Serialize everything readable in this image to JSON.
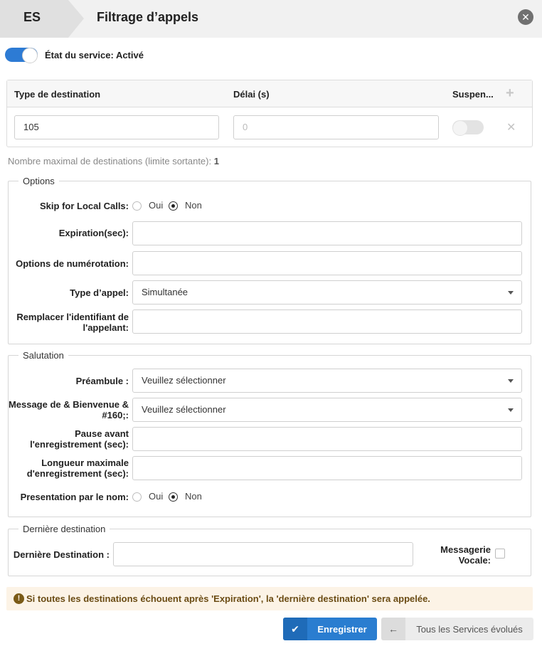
{
  "header": {
    "badge": "ES",
    "title": "Filtrage d’appels"
  },
  "service": {
    "status_label": "État du service: Activé",
    "enabled": true
  },
  "destinations": {
    "columns": {
      "type": "Type de destination",
      "delay": "Délai (s)",
      "suspend": "Suspen..."
    },
    "rows": [
      {
        "type": "105",
        "delay": "0",
        "suspended": false
      }
    ],
    "limit_label": "Nombre maximal de destinations (limite sortante):",
    "limit_value": "1"
  },
  "options": {
    "legend": "Options",
    "skip_local_calls": {
      "label": "Skip for Local Calls:",
      "yes": "Oui",
      "no": "Non",
      "selected": "no"
    },
    "expiration": {
      "label": "Expiration(sec):",
      "value": ""
    },
    "dial_options": {
      "label": "Options de numérotation:",
      "value": ""
    },
    "call_type": {
      "label": "Type d’appel:",
      "value": "Simultanée"
    },
    "replace_caller_id": {
      "label": "Remplacer l'identifiant de l'appelant:",
      "value": ""
    }
  },
  "greeting": {
    "legend": "Salutation",
    "preamble": {
      "label": "Préambule :",
      "value": "Veuillez sélectionner"
    },
    "welcome": {
      "label": "Message de & Bienvenue & #160;:",
      "value": "Veuillez sélectionner"
    },
    "pause": {
      "label": "Pause avant l'enregistrement (sec):",
      "value": ""
    },
    "max_length": {
      "label": "Longueur maximale d'enregistrement (sec):",
      "value": ""
    },
    "name_presentation": {
      "label": "Presentation par le nom:",
      "yes": "Oui",
      "no": "Non",
      "selected": "no"
    }
  },
  "last_destination": {
    "legend": "Dernière destination",
    "label": "Dernière Destination :",
    "value": "",
    "voicemail_label": "Messagerie Vocale:",
    "voicemail_checked": false
  },
  "alert": {
    "text": "Si toutes les destinations échouent après 'Expiration', la 'dernière destination' sera appelée."
  },
  "buttons": {
    "save": "Enregistrer",
    "back": "Tous les Services évolués"
  },
  "colors": {
    "primary": "#2a7dd0",
    "alert_bg": "#fcf3e6",
    "alert_text": "#6b4c14"
  },
  "icons": {
    "close": "close-circle-icon",
    "add": "plus-icon",
    "remove": "x-icon",
    "alert": "exclamation-icon",
    "save": "check-icon",
    "back": "arrow-left-icon"
  }
}
